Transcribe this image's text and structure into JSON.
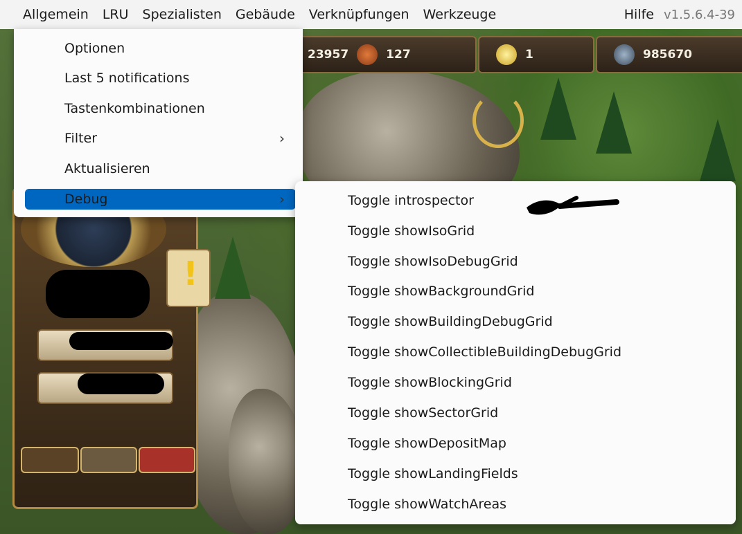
{
  "menubar": {
    "items": [
      "Allgemein",
      "LRU",
      "Spezialisten",
      "Gebäude",
      "Verknüpfungen",
      "Werkzeuge"
    ],
    "help": "Hilfe",
    "version": "v1.5.6.4-39"
  },
  "resources": {
    "population": "23957",
    "buildings": "127",
    "stars": "1",
    "tools": "985670"
  },
  "main_menu": {
    "items": [
      {
        "label": "Optionen",
        "submenu": false,
        "selected": false
      },
      {
        "label": "Last 5 notifications",
        "submenu": false,
        "selected": false
      },
      {
        "label": "Tastenkombinationen",
        "submenu": false,
        "selected": false
      },
      {
        "label": "Filter",
        "submenu": true,
        "selected": false
      },
      {
        "label": "Aktualisieren",
        "submenu": false,
        "selected": false
      },
      {
        "label": "Debug",
        "submenu": true,
        "selected": true
      }
    ],
    "arrow": "›"
  },
  "debug_menu": {
    "items": [
      "Toggle introspector",
      "Toggle showIsoGrid",
      "Toggle showIsoDebugGrid",
      "Toggle showBackgroundGrid",
      "Toggle showBuildingDebugGrid",
      "Toggle showCollectibleBuildingDebugGrid",
      "Toggle showBlockingGrid",
      "Toggle showSectorGrid",
      "Toggle showDepositMap",
      "Toggle showLandingFields",
      "Toggle showWatchAreas"
    ]
  },
  "colors": {
    "selection": "#0067c0",
    "menu_bg": "#fbfbfb",
    "menubar_bg": "#f3f3f3"
  }
}
